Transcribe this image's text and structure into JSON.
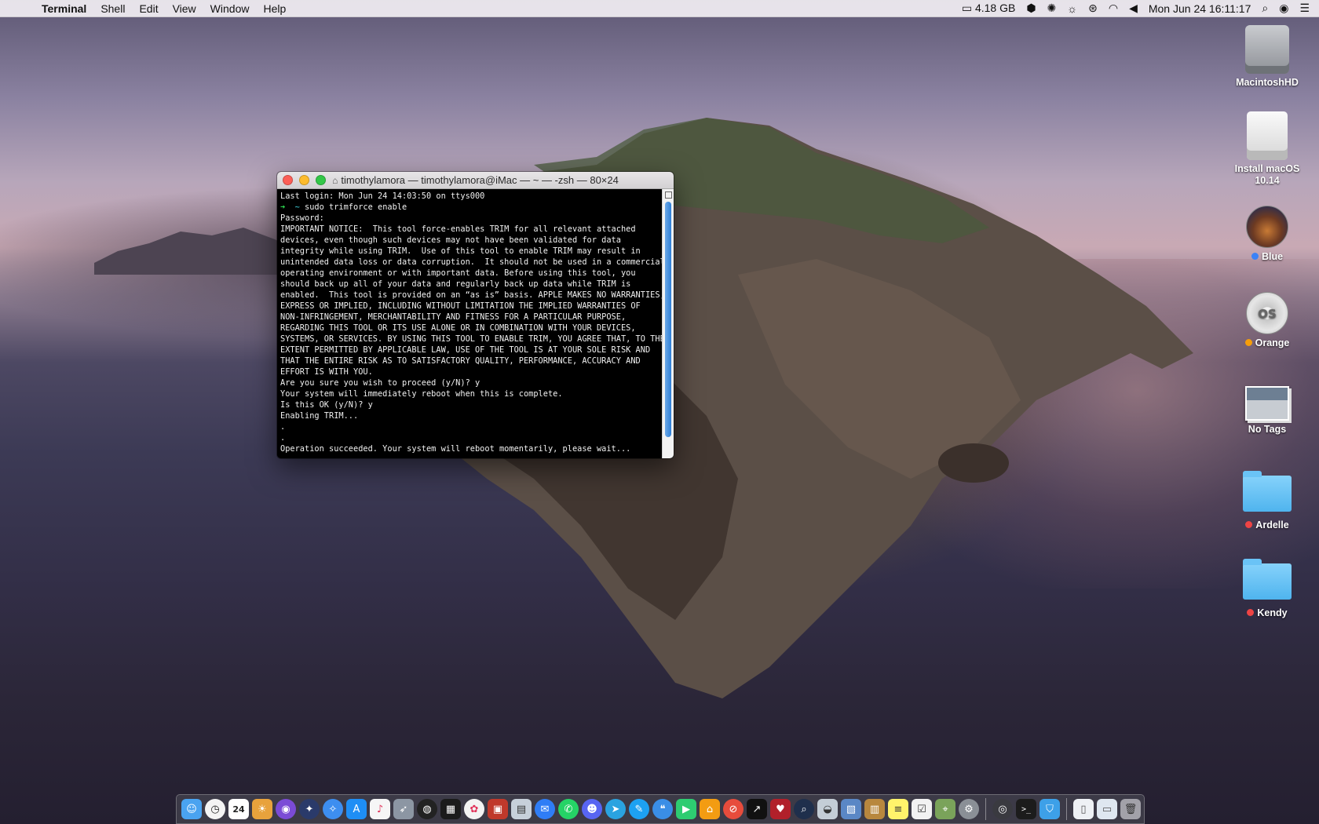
{
  "menubar": {
    "app_name": "Terminal",
    "menus": [
      "Shell",
      "Edit",
      "View",
      "Window",
      "Help"
    ],
    "memory": "4.18 GB",
    "datetime": "Mon Jun 24  16:11:17"
  },
  "terminal": {
    "title": "timothylamora — timothylamora@iMac — ~ — -zsh — 80×24",
    "lines": [
      "Last login: Mon Jun 24 14:03:50 on ttys000",
      "Password:",
      "IMPORTANT NOTICE:  This tool force-enables TRIM for all relevant attached",
      "devices, even though such devices may not have been validated for data",
      "integrity while using TRIM.  Use of this tool to enable TRIM may result in",
      "unintended data loss or data corruption.  It should not be used in a commercial",
      "operating environment or with important data. Before using this tool, you",
      "should back up all of your data and regularly back up data while TRIM is",
      "enabled.  This tool is provided on an “as is” basis. APPLE MAKES NO WARRANTIES,",
      "EXPRESS OR IMPLIED, INCLUDING WITHOUT LIMITATION THE IMPLIED WARRANTIES OF",
      "NON-INFRINGEMENT, MERCHANTABILITY AND FITNESS FOR A PARTICULAR PURPOSE,",
      "REGARDING THIS TOOL OR ITS USE ALONE OR IN COMBINATION WITH YOUR DEVICES,",
      "SYSTEMS, OR SERVICES. BY USING THIS TOOL TO ENABLE TRIM, YOU AGREE THAT, TO THE",
      "EXTENT PERMITTED BY APPLICABLE LAW, USE OF THE TOOL IS AT YOUR SOLE RISK AND",
      "THAT THE ENTIRE RISK AS TO SATISFACTORY QUALITY, PERFORMANCE, ACCURACY AND",
      "EFFORT IS WITH YOU.",
      "Are you sure you wish to proceed (y/N)? y",
      "Your system will immediately reboot when this is complete.",
      "Is this OK (y/N)? y",
      "Enabling TRIM...",
      ".",
      ".",
      "Operation succeeded. Your system will reboot momentarily, please wait..."
    ],
    "prompt_arrow": "➜",
    "prompt_dir": "~",
    "command": "sudo trimforce enable"
  },
  "desktop_icons": [
    {
      "label": "MacintoshHD",
      "tag": ""
    },
    {
      "label": "Install macOS 10.14",
      "tag": ""
    },
    {
      "label": "Blue",
      "tag": "#3b82f6"
    },
    {
      "label": "Orange",
      "tag": "#f59e0b"
    },
    {
      "label": "No Tags",
      "tag": ""
    },
    {
      "label": "Ardelle",
      "tag": "#ef4444"
    },
    {
      "label": "Kendy",
      "tag": "#ef4444"
    }
  ],
  "dock": {
    "calendar_day": "24"
  }
}
